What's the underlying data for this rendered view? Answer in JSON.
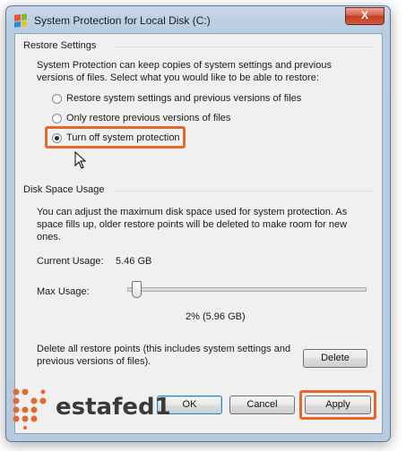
{
  "window": {
    "title": "System Protection for Local Disk (C:)",
    "close_label": "X"
  },
  "restore": {
    "heading": "Restore Settings",
    "description": "System Protection can keep copies of system settings and previous versions of files. Select what you would like to be able to restore:",
    "options": [
      {
        "label": "Restore system settings and previous versions of files",
        "selected": false
      },
      {
        "label": "Only restore previous versions of files",
        "selected": false
      },
      {
        "label": "Turn off system protection",
        "selected": true
      }
    ]
  },
  "disk": {
    "heading": "Disk Space Usage",
    "description": "You can adjust the maximum disk space used for system protection. As space fills up, older restore points will be deleted to make room for new ones.",
    "current_label": "Current Usage:",
    "current_value": "5.46 GB",
    "max_label": "Max Usage:",
    "max_percent": 2,
    "max_value_text": "2% (5.96 GB)",
    "delete_text": "Delete all restore points (this includes system settings and previous versions of files).",
    "delete_label": "Delete"
  },
  "buttons": {
    "ok": "OK",
    "cancel": "Cancel",
    "apply": "Apply"
  },
  "watermark": {
    "text": "estafed1"
  },
  "colors": {
    "highlight": "#e36a2c",
    "close": "#c23c22",
    "logo": "#e36a2c"
  }
}
